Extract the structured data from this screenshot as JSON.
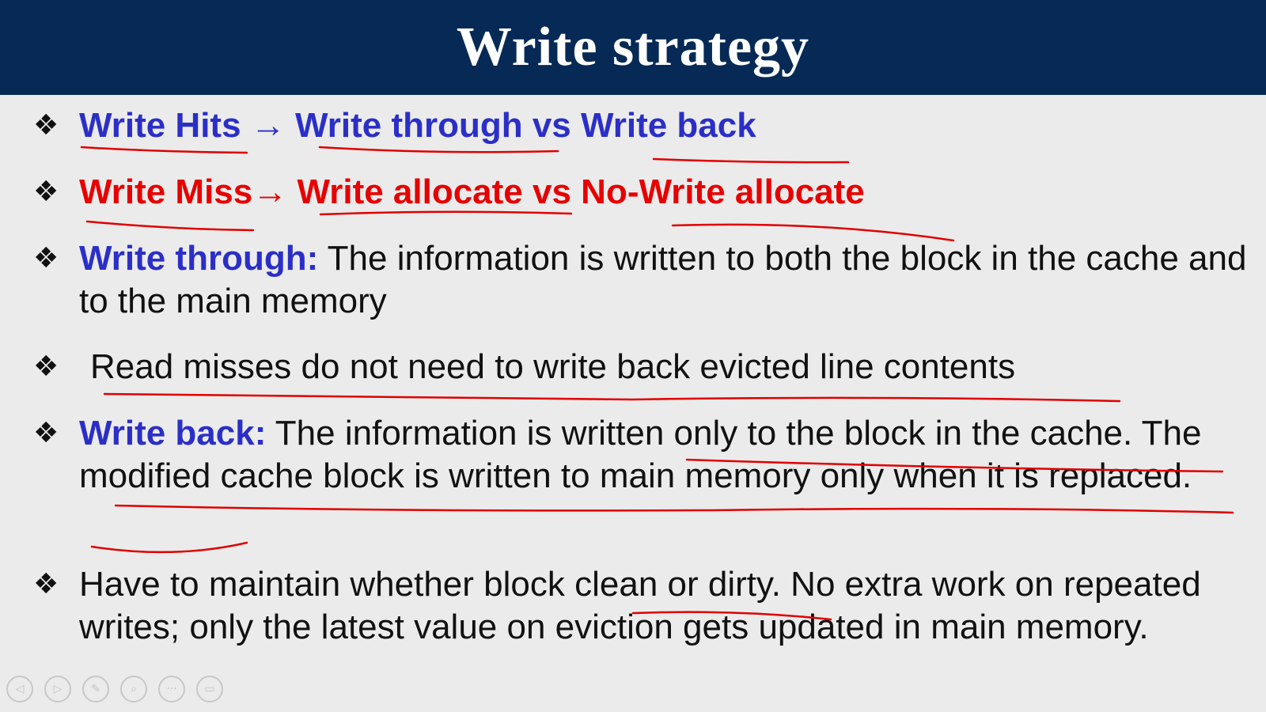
{
  "slide": {
    "title": "Write strategy",
    "bullet_symbol": "❖",
    "bullets": [
      {
        "parts": [
          {
            "text": "Write Hits",
            "style": "blue"
          },
          {
            "text": " → ",
            "style": "blue"
          },
          {
            "text": "Write through",
            "style": "blue"
          },
          {
            "text": " vs ",
            "style": "blue"
          },
          {
            "text": "Write back",
            "style": "blue"
          }
        ]
      },
      {
        "parts": [
          {
            "text": "Write Miss",
            "style": "red"
          },
          {
            "text": "→ ",
            "style": "red"
          },
          {
            "text": "Write allocate",
            "style": "red"
          },
          {
            "text": " vs ",
            "style": "red"
          },
          {
            "text": "No-Write allocate",
            "style": "red"
          }
        ]
      },
      {
        "parts": [
          {
            "text": "Write through:",
            "style": "blue"
          },
          {
            "text": " The information is written to both the block in the cache and to the main memory",
            "style": "plain"
          }
        ]
      },
      {
        "parts": [
          {
            "text": "Read misses do not need to write back evicted line contents",
            "style": "plain"
          }
        ]
      },
      {
        "parts": [
          {
            "text": "Write back:",
            "style": "blue"
          },
          {
            "text": " The information is written only to the block in the cache. The modified cache block is written to main memory only when it is replaced.",
            "style": "plain"
          }
        ]
      },
      {
        "parts": [
          {
            "text": "Have to maintain whether block clean or dirty. No extra work on repeated writes; only the latest value on eviction gets updated in main memory.",
            "style": "plain"
          }
        ]
      }
    ]
  },
  "annotation": {
    "ink_color": "#e00000"
  },
  "player_controls": [
    {
      "name": "previous-icon",
      "glyph": "◁"
    },
    {
      "name": "next-icon",
      "glyph": "▷"
    },
    {
      "name": "pen-icon",
      "glyph": "✎"
    },
    {
      "name": "zoom-icon",
      "glyph": "⌕"
    },
    {
      "name": "more-icon",
      "glyph": "···"
    },
    {
      "name": "screen-icon",
      "glyph": "▭"
    }
  ]
}
